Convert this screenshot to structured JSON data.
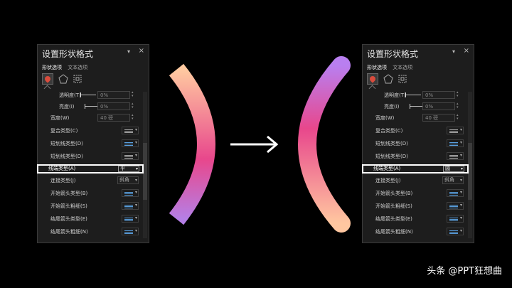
{
  "panels": {
    "left": {
      "title": "设置形状格式",
      "tab_shape": "形状选项",
      "tab_text": "文本选项",
      "transparency_label": "透明度(T)",
      "transparency_value": "0%",
      "brightness_label": "亮度(I)",
      "brightness_value": "0%",
      "width_label": "宽度(W)",
      "width_value": "40 磅",
      "compound_label": "复合类型(C)",
      "dash_label": "短划线类型(D)",
      "cap_label": "线端类型(A)",
      "cap_value": "平",
      "join_label": "连接类型(J)",
      "join_value": "斜角",
      "begin_arrow_type_label": "开始箭头类型(B)",
      "begin_arrow_size_label": "开始箭头粗细(S)",
      "end_arrow_type_label": "结尾箭头类型(E)",
      "end_arrow_size_label": "结尾箭头粗细(N)"
    },
    "right": {
      "title": "设置形状格式",
      "tab_shape": "形状选项",
      "tab_text": "文本选项",
      "transparency_label": "透明度(T)",
      "transparency_value": "0%",
      "brightness_label": "亮度(I)",
      "brightness_value": "0%",
      "width_label": "宽度(W)",
      "width_value": "40 磅",
      "compound_label": "复合类型(C)",
      "dash_label": "短划线类型(D)",
      "cap_label": "线端类型(A)",
      "cap_value": "圆",
      "join_label": "连接类型(J)",
      "join_value": "斜角",
      "begin_arrow_type_label": "开始箭头类型(B)",
      "begin_arrow_size_label": "开始箭头粗细(S)",
      "end_arrow_type_label": "结尾箭头类型(E)",
      "end_arrow_size_label": "结尾箭头粗细(N)"
    }
  },
  "pin_glyph": "▾",
  "close_glyph": "×",
  "gradient": {
    "top": "#ffc9a0",
    "mid": "#e8478c",
    "bottom": "#b57fe6"
  },
  "gradient_right": {
    "top": "#b97ff0",
    "mid": "#e8478c",
    "bottom": "#ffc7a0"
  },
  "watermark": "头条 @PPT狂想曲"
}
